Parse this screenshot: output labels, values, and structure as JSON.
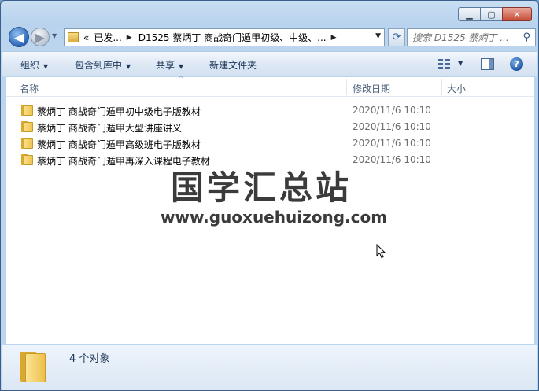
{
  "window": {
    "minimize_glyph": "▁",
    "maximize_glyph": "▢",
    "close_glyph": "✕"
  },
  "nav": {
    "back_glyph": "◀",
    "forward_glyph": "▶",
    "recent_glyph": "▼"
  },
  "address": {
    "overflow": "«",
    "segments": [
      "已发...",
      "D1525 蔡炳丁 商战奇门遁甲初级、中级、..."
    ],
    "separator_glyph": "▶",
    "dropdown_glyph": "▼",
    "refresh_glyph": "⟳"
  },
  "search": {
    "placeholder": "搜索 D1525 蔡炳丁 ...",
    "icon": "search-icon",
    "icon_glyph": "⚲"
  },
  "toolbar": {
    "organize": "组织",
    "include_in_library": "包含到库中",
    "share": "共享",
    "new_folder": "新建文件夹",
    "arrow_glyph": "▼",
    "help_glyph": "?"
  },
  "columns": {
    "name": "名称",
    "date_modified": "修改日期",
    "size": "大小",
    "sort_glyph": "^"
  },
  "files": [
    {
      "name": "蔡炳丁 商战奇门遁甲初中级电子版教材",
      "date": "2020/11/6 10:10"
    },
    {
      "name": "蔡炳丁 商战奇门遁甲大型讲座讲义",
      "date": "2020/11/6 10:10"
    },
    {
      "name": "蔡炳丁 商战奇门遁甲高级班电子版教材",
      "date": "2020/11/6 10:10"
    },
    {
      "name": "蔡炳丁 商战奇门遁甲再深入课程电子教材",
      "date": "2020/11/6 10:10"
    }
  ],
  "watermark": {
    "title": "国学汇总站",
    "url": "www.guoxuehuizong.com"
  },
  "details": {
    "item_count": "4 个对象"
  },
  "colors": {
    "window_frame": "#b9d3ee",
    "folder_yellow": "#eec551",
    "close_red": "#c54a35"
  }
}
